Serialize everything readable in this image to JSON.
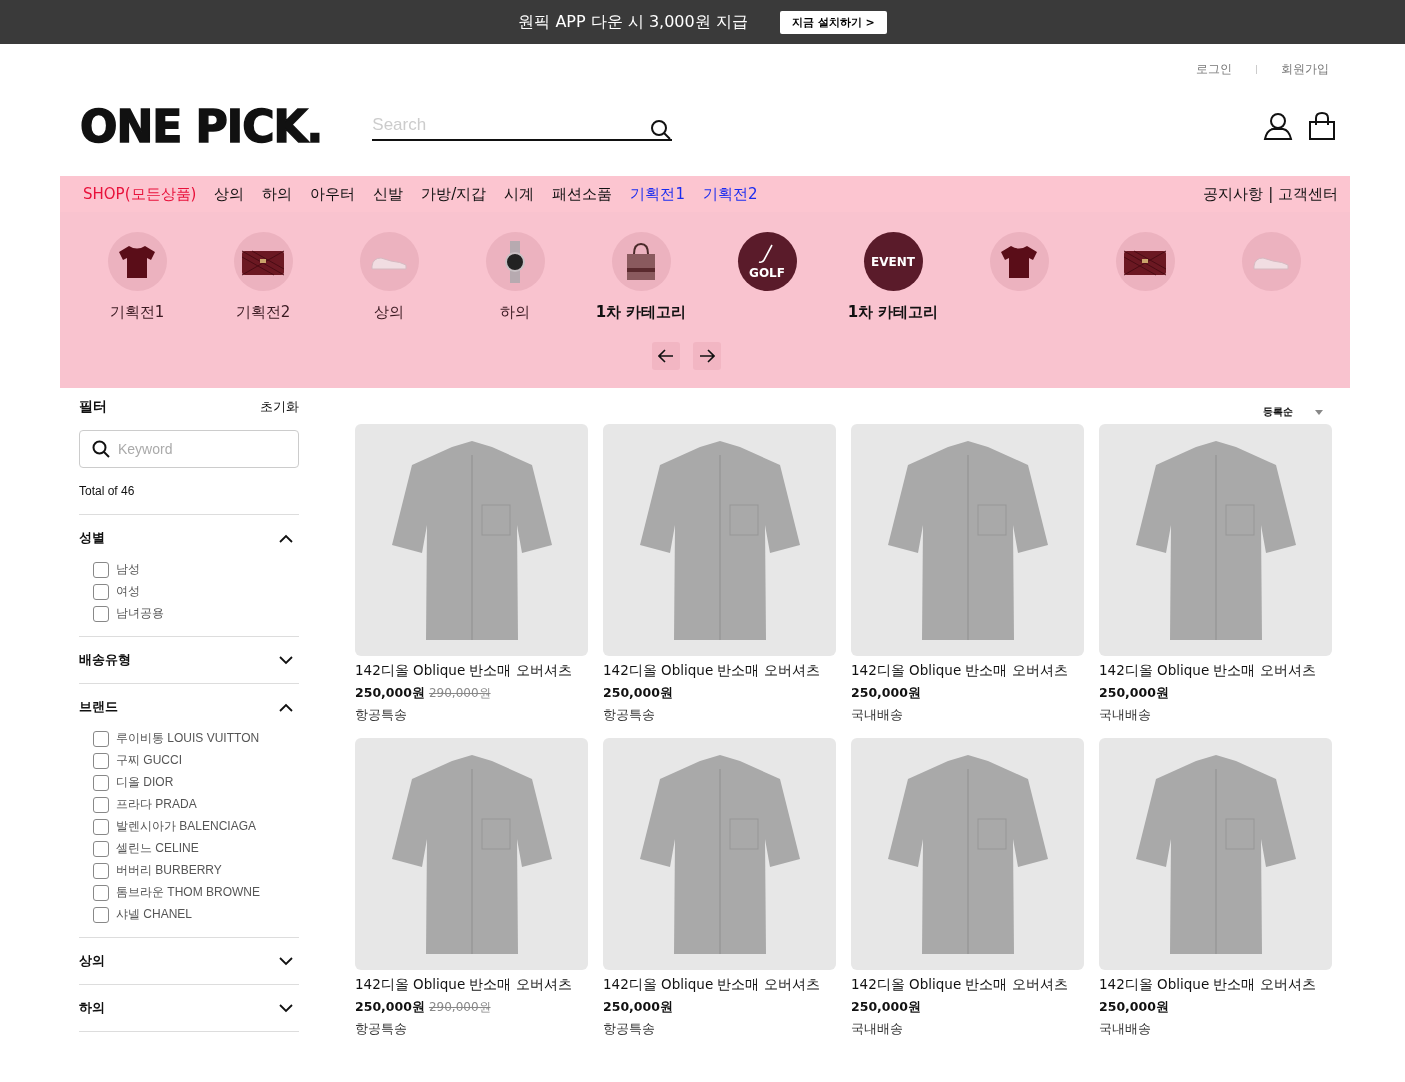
{
  "promo_bar": {
    "text": "원픽 APP 다운 시 3,000원 지급",
    "button": "지금 설치하기 >"
  },
  "util_links": [
    "로그인",
    "회원가입"
  ],
  "logo": "ONE PICK.",
  "search": {
    "placeholder": "Search"
  },
  "nav": {
    "items": [
      {
        "label": "SHOP(모든상품)",
        "kind": "all"
      },
      {
        "label": "상의",
        "kind": "category"
      },
      {
        "label": "하의",
        "kind": "category"
      },
      {
        "label": "아우터",
        "kind": "category"
      },
      {
        "label": "신발",
        "kind": "category"
      },
      {
        "label": "가방/지갑",
        "kind": "category"
      },
      {
        "label": "시계",
        "kind": "category"
      },
      {
        "label": "패션소품",
        "kind": "category"
      },
      {
        "label": "기획전1",
        "kind": "promo"
      },
      {
        "label": "기획전2",
        "kind": "promo"
      }
    ],
    "right": "공지사항 | 고객센터"
  },
  "category_carousel": [
    {
      "kind": "tshirt",
      "label": "기획전1"
    },
    {
      "kind": "bag",
      "label": "기획전2"
    },
    {
      "kind": "sneaker",
      "label": "상의"
    },
    {
      "kind": "watch",
      "label": "하의"
    },
    {
      "kind": "tote",
      "label": "1차 카테고리"
    },
    {
      "kind": "badge",
      "badge": "GOLF"
    },
    {
      "kind": "badge",
      "badge": "EVENT",
      "label": "1차 카테고리"
    },
    {
      "kind": "tshirt"
    },
    {
      "kind": "bag"
    },
    {
      "kind": "sneaker"
    }
  ],
  "filter": {
    "title": "필터",
    "reset": "초기화",
    "keyword_placeholder": "Keyword",
    "total": "Total of 46",
    "sections": [
      {
        "title": "성별",
        "expanded": true,
        "options": [
          {
            "label": "남성",
            "checked": false
          },
          {
            "label": "여성",
            "checked": false
          },
          {
            "label": "남녀공용",
            "checked": false
          }
        ]
      },
      {
        "title": "배송유형",
        "expanded": false
      },
      {
        "title": "브랜드",
        "expanded": true,
        "options": [
          {
            "label": "루이비통 LOUIS VUITTON",
            "checked": false
          },
          {
            "label": "구찌 GUCCI",
            "checked": false
          },
          {
            "label": "디올 DIOR",
            "checked": false
          },
          {
            "label": "프라다 PRADA",
            "checked": false
          },
          {
            "label": "발렌시아가 BALENCIAGA",
            "checked": false
          },
          {
            "label": "셀린느 CELINE",
            "checked": false
          },
          {
            "label": "버버리 BURBERRY",
            "checked": false
          },
          {
            "label": "톰브라운 THOM BROWNE",
            "checked": false
          },
          {
            "label": "샤넬 CHANEL",
            "checked": false
          }
        ]
      },
      {
        "title": "상의",
        "expanded": false
      },
      {
        "title": "하의",
        "expanded": false
      }
    ]
  },
  "sort": "등록순",
  "products": [
    {
      "name": "142디올 Oblique 반소매 오버셔츠",
      "price": "250,000원",
      "original_price": "290,000원",
      "shipping": "항공특송"
    },
    {
      "name": "142디올 Oblique 반소매 오버셔츠",
      "price": "250,000원",
      "shipping": "항공특송"
    },
    {
      "name": "142디올 Oblique 반소매 오버셔츠",
      "price": "250,000원",
      "shipping": "국내배송"
    },
    {
      "name": "142디올 Oblique 반소매 오버셔츠",
      "price": "250,000원",
      "shipping": "국내배송"
    },
    {
      "name": "142디올 Oblique 반소매 오버셔츠",
      "price": "250,000원",
      "original_price": "290,000원",
      "shipping": "항공특송"
    },
    {
      "name": "142디올 Oblique 반소매 오버셔츠",
      "price": "250,000원",
      "shipping": "항공특송"
    },
    {
      "name": "142디올 Oblique 반소매 오버셔츠",
      "price": "250,000원",
      "shipping": "국내배송"
    },
    {
      "name": "142디올 Oblique 반소매 오버셔츠",
      "price": "250,000원",
      "shipping": "국내배송"
    }
  ]
}
